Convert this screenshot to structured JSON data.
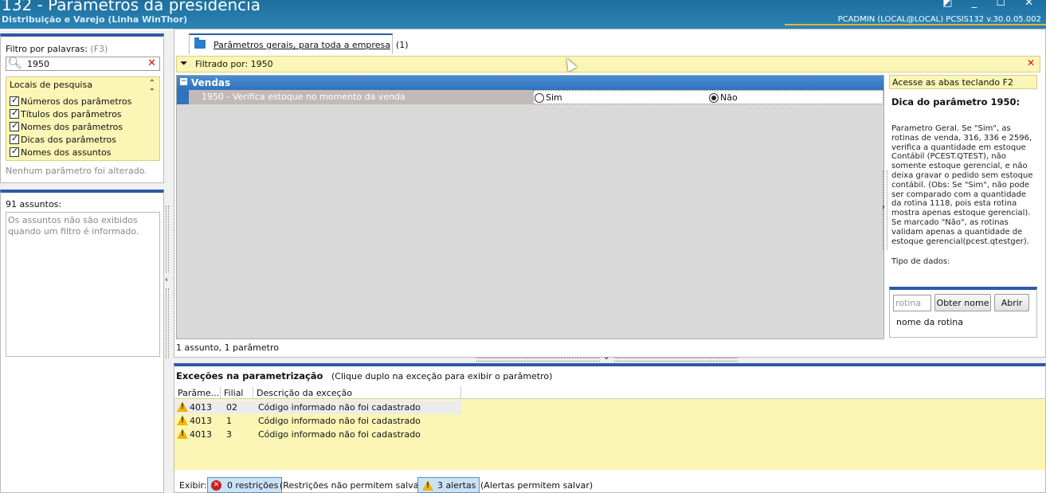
{
  "window": {
    "title": "132 - Parâmetros da presidência",
    "subtitle": "Distribuição e Varejo (Linha WinThor)",
    "status_right": "PCADMIN (LOCAL@LOCAL)   PCSIS132  v.30.0.05.002",
    "controls": "◩ _ ☐ ✕"
  },
  "filter": {
    "label": "Filtro por palavras:",
    "hint": "(F3)",
    "value": "1950",
    "clear": "✕"
  },
  "locais": {
    "title": "Locais de pesquisa",
    "collapse_icon": "chevron-up-double",
    "items": [
      {
        "label": "Números dos parâmetros",
        "checked": true
      },
      {
        "label": "Títulos dos parâmetros",
        "checked": true
      },
      {
        "label": "Nomes dos parâmetros",
        "checked": true
      },
      {
        "label": "Dicas dos parâmetros",
        "checked": true
      },
      {
        "label": "Nomes dos assuntos",
        "checked": true
      }
    ],
    "status": "Nenhum parâmetro foi alterado."
  },
  "assuntos": {
    "count_label": "91 assuntos:",
    "message": "Os assuntos não são exibidos quando um filtro é informado."
  },
  "tab": {
    "label": "Parâmetros gerais, para toda a empresa",
    "count": "(1)"
  },
  "filterbar": {
    "text": "Filtrado por: 1950",
    "close": "✕"
  },
  "grid": {
    "group": "Vendas",
    "param": "1950 - Verifica estoque  no momento da venda",
    "option_sim": "Sim",
    "option_nao": "Não",
    "selected": "Não",
    "footer": "1 assunto, 1 parâmetro"
  },
  "tip": {
    "banner": "Acesse as abas teclando F2",
    "title": "Dica do parâmetro 1950:",
    "body": "Parametro Geral. Se \"Sim\", as rotinas de venda, 316, 336 e 2596, verifica a quantidade em estoque Contábil (PCEST.QTEST), não somente estoque gerencial, e não deixa gravar o pedido sem estoque contábil.  (Obs: Se \"Sim\", não pode ser comparado com a quantidade da rotina 1118, pois esta rotina mostra apenas estoque gerencial). Se marcado \"Não\", as rotinas validam apenas a quantidade de estoque gerencial(pcest.qtestger).",
    "cut": "Tipo de dados:"
  },
  "rotina": {
    "placeholder": "rotina",
    "btn_obter": "Obter nome",
    "btn_abrir": "Abrir",
    "name_label": "nome da rotina"
  },
  "excecoes": {
    "title": "Exceções na parametrização",
    "subtitle": "(Clique duplo na exceção para exibir o parâmetro)",
    "columns": [
      "Parâme...",
      "Filial",
      "Descrição da exceção"
    ],
    "rows": [
      {
        "param": "4013",
        "filial": "02",
        "desc": "Código informado não foi cadastrado"
      },
      {
        "param": "4013",
        "filial": "1",
        "desc": "Código informado não foi cadastrado"
      },
      {
        "param": "4013",
        "filial": "3",
        "desc": "Código informado não foi cadastrado"
      }
    ],
    "exibir": "Exibir:",
    "restricoes_btn": "0 restrições",
    "restricoes_note": "(Restrições não permitem salvar)",
    "alertas_btn": "3 alertas",
    "alertas_note": "(Alertas permitem salvar)"
  },
  "colors": {
    "titlebar": "#2a84b5",
    "accent": "#2d5aa6",
    "highlight": "#fbf6b5",
    "group": "#2f73bc"
  }
}
